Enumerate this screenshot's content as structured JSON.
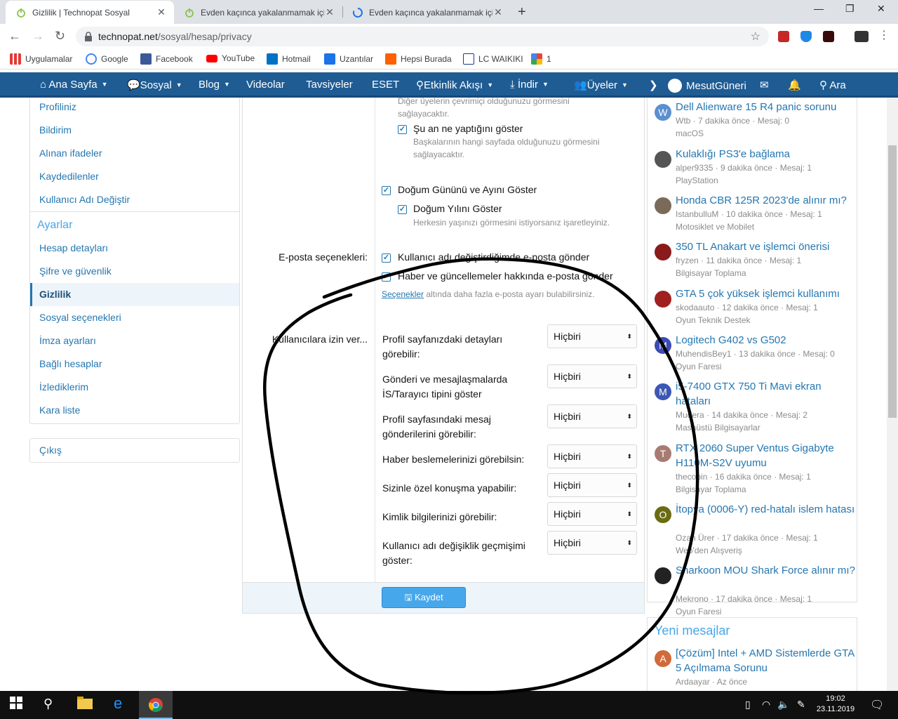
{
  "browser": {
    "tabs": [
      {
        "title": "Gizlilik | Technopat Sosyal"
      },
      {
        "title": "Evden kaçınca yakalanmamak için"
      },
      {
        "title": "Evden kaçınca yakalanmamak için"
      }
    ],
    "new_tab_glyph": "+",
    "url_domain": "technopat.net",
    "url_path": "/sosyal/hesap/privacy",
    "bookmarks": [
      "Uygulamalar",
      "Google",
      "Facebook",
      "YouTube",
      "Hotmail",
      "Uzantılar",
      "Hepsi Burada",
      "LC WAIKIKI",
      "1"
    ]
  },
  "site_nav": {
    "items": [
      "Ana Sayfa",
      "Sosyal",
      "Blog",
      "Videolar",
      "Tavsiyeler",
      "ESET",
      "Etkinlik Akışı",
      "İndir",
      "Üyeler"
    ],
    "user": "MesutGüneri",
    "search": "Ara"
  },
  "sidebar": {
    "account_items": [
      "Profiliniz",
      "Bildirim",
      "Alınan ifadeler",
      "Kaydedilenler",
      "Kullanıcı Adı Değiştir"
    ],
    "settings_heading": "Ayarlar",
    "settings_items": [
      "Hesap detayları",
      "Şifre ve güvenlik",
      "Gizlilik",
      "Sosyal seçenekleri",
      "İmza ayarları",
      "Bağlı hesaplar",
      "İzlediklerim",
      "Kara liste"
    ],
    "logout": "Çıkış"
  },
  "privacy_form": {
    "top_hint": "Diğer üyelerin çevrimiçi olduğunuzu görmesini sağlayacaktır.",
    "show_activity": {
      "label": "Şu an ne yaptığını göster",
      "hint": "Başkalarının hangi sayfada olduğunuzu görmesini sağlayacaktır.",
      "checked": true
    },
    "show_birthday": {
      "label": "Doğum Gününü ve Ayını Göster",
      "checked": true
    },
    "show_birth_year": {
      "label": "Doğum Yılını Göster",
      "hint": "Herkesin yaşınızı görmesini istiyorsanız işaretleyiniz.",
      "checked": true
    },
    "email_label": "E-posta seçenekleri:",
    "email_on_rename": {
      "label": "Kullanıcı adı değiştirdiğimde e-posta gönder",
      "checked": true
    },
    "email_news": {
      "label": "Haber ve güncellemeler hakkında e-posta gönder",
      "checked": true
    },
    "email_more_link": "Seçenekler",
    "email_more_text": " altında daha fazla e-posta ayarı bulabilirsiniz.",
    "allow_label": "Kullanıcılara izin ver...",
    "permissions": [
      {
        "label": "Profil sayfanızdaki detayları görebilir:",
        "value": "Hiçbiri"
      },
      {
        "label": "Gönderi ve mesajlaşmalarda İS/Tarayıcı tipini göster",
        "value": "Hiçbiri"
      },
      {
        "label": "Profil sayfasındaki mesaj gönderilerini görebilir:",
        "value": "Hiçbiri"
      },
      {
        "label": "Haber beslemelerinizi görebilsin:",
        "value": "Hiçbiri"
      },
      {
        "label": "Sizinle özel konuşma yapabilir:",
        "value": "Hiçbiri"
      },
      {
        "label": "Kimlik bilgilerinizi görebilir:",
        "value": "Hiçbiri"
      },
      {
        "label": "Kullanıcı adı değişiklik geçmişimi göster:",
        "value": "Hiçbiri"
      }
    ],
    "save_label": "Kaydet"
  },
  "latest_threads": [
    {
      "avatar": "W",
      "color": "#5b8fd1",
      "title": "Dell Alienware 15 R4 panic sorunu",
      "meta": "Wtb · 7 dakika önce · Mesaj: 0",
      "forum": "macOS"
    },
    {
      "avatar": "",
      "color": "#555555",
      "title": "Kulaklığı PS3'e bağlama",
      "meta": "alper9335 · 9 dakika önce · Mesaj: 1",
      "forum": "PlayStation"
    },
    {
      "avatar": "",
      "color": "#7a6a5a",
      "title": "Honda CBR 125R 2023'de alınır mı?",
      "meta": "IstanbulluM · 10 dakika önce · Mesaj: 1",
      "forum": "Motosiklet ve Mobilet"
    },
    {
      "avatar": "",
      "color": "#8b1a1a",
      "title": "350 TL Anakart ve işlemci önerisi",
      "meta": "fryzen · 11 dakika önce · Mesaj: 1",
      "forum": "Bilgisayar Toplama"
    },
    {
      "avatar": "",
      "color": "#a02020",
      "title": "GTA 5 çok yüksek işlemci kullanımı",
      "meta": "skodaauto · 12 dakika önce · Mesaj: 1",
      "forum": "Oyun Teknik Destek"
    },
    {
      "avatar": "M",
      "color": "#3c4bb5",
      "title": "Logitech G402 vs G502",
      "meta": "MuhendisBey1 · 13 dakika önce · Mesaj: 0",
      "forum": "Oyun Faresi"
    },
    {
      "avatar": "M",
      "color": "#3c58b5",
      "title": "i5-7400 GTX 750 Ti Mavi ekran hataları",
      "meta": "Mudera · 14 dakika önce · Mesaj: 2",
      "forum": "Masaüstü Bilgisayarlar"
    },
    {
      "avatar": "T",
      "color": "#a87b72",
      "title": "RTX 2060 Super Ventus Gigabyte H110M-S2V uyumu",
      "meta": "thecobin · 16 dakika önce · Mesaj: 1",
      "forum": "Bilgisayar Toplama"
    },
    {
      "avatar": "O",
      "color": "#6b6b12",
      "title": "İtopya (0006-Y) red-hatalı islem hatası",
      "meta": "Ozan Ürer · 17 dakika önce · Mesaj: 1",
      "forum": "Web'den Alışveriş"
    },
    {
      "avatar": "",
      "color": "#222222",
      "title": "Sharkoon MOU Shark Force alınır mı?",
      "meta": "Mekrono · 17 dakika önce · Mesaj: 1",
      "forum": "Oyun Faresi"
    }
  ],
  "new_posts": {
    "heading": "Yeni mesajlar",
    "first": {
      "avatar": "A",
      "color": "#d06a3a",
      "title": "[Çözüm] Intel + AMD Sistemlerde GTA 5 Açılmama Sorunu",
      "meta": "Ardaayar · Az önce"
    }
  },
  "taskbar": {
    "time": "19:02",
    "date": "23.11.2019"
  },
  "colors": {
    "nav_bg": "#1f5c93",
    "link": "#2577b1",
    "accent": "#47a7eb"
  }
}
